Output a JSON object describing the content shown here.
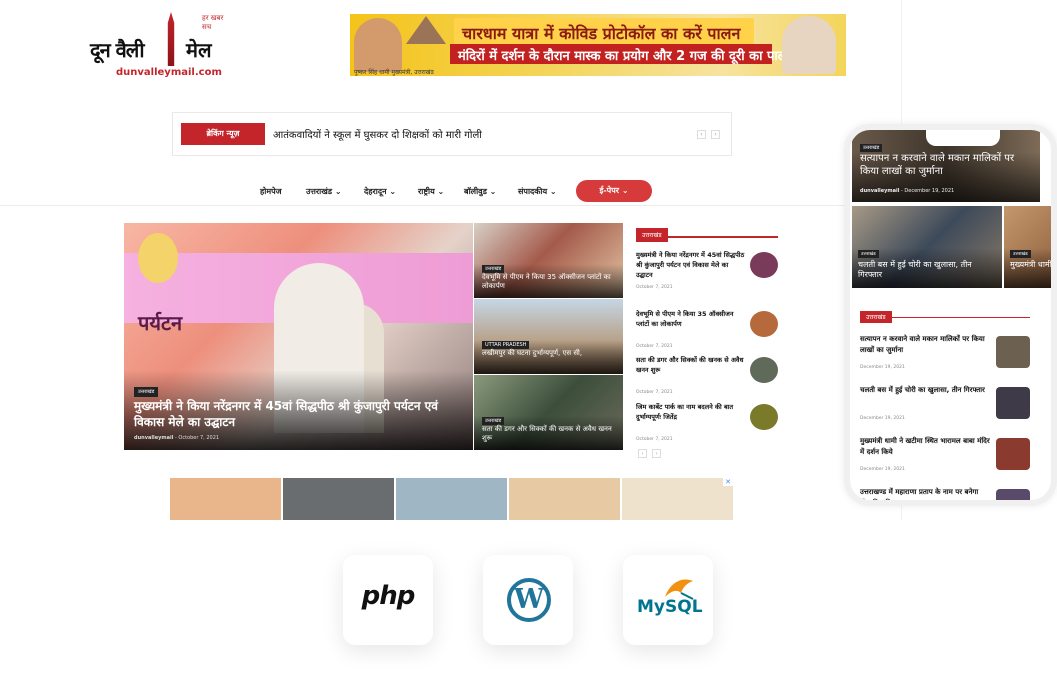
{
  "logo": {
    "name": "दून वैली मेल",
    "left": "दून वैली",
    "right": "मेल",
    "url": "dunvalleymail.com",
    "tagline": "हर खबर सच"
  },
  "ad_top": {
    "line1": "चारधाम यात्रा में कोविड प्रोटोकॉल का करें पालन",
    "line2": "मंदिरों में दर्शन के दौरान मास्क का प्रयोग और 2 गज की दूरी का पालन करें",
    "line3": "पुष्कर सिंह धामी मुख्यमंत्री, उत्तराखंड"
  },
  "breaking": {
    "label": "ब्रेकिंग न्यूज़",
    "text": "आतंकवादियों ने स्कूल में घुसकर दो शिक्षकों को मारी गोली",
    "prev": "‹",
    "next": "›"
  },
  "nav": {
    "items": [
      "होमपेज",
      "उत्तराखंड",
      "देहरादून",
      "राष्ट्रीय",
      "बॉलीवुड",
      "संपादकीय"
    ],
    "epaper": "ई-पेपर"
  },
  "hero": {
    "badge": "उत्तराखंड",
    "title": "मुख्यमंत्री ने किया नरेंद्रनगर में 45वां सिद्धपीठ श्री कुंजापुरी पर्यटन एवं विकास मेले का उद्घाटन",
    "author": "dunvalleymail",
    "date": "October 7, 2021",
    "banner_text": "पर्यटन"
  },
  "tiles": [
    {
      "badge": "उत्तराखंड",
      "title": "देवभूमि से पीएम ने किया 35 ऑक्सीजन प्लांटों का लोकार्पण"
    },
    {
      "badge": "UTTAR PRADESH",
      "title": "लखीमपुर की घटना दुर्भाग्यपूर्ण, एस सी,"
    },
    {
      "badge": "उत्तराखंड",
      "title": "सता की डगर और सिक्कों की खनक से अवैध खनन शुरू"
    }
  ],
  "side": {
    "heading": "उत्तराखंड",
    "items": [
      {
        "title": "मुख्यमंत्री ने किया नरेंद्रनगर में 45वां सिद्धपीठ श्री कुंजापुरी पर्यटन एवं विकास मेले का उद्घाटन",
        "date": "October 7, 2021"
      },
      {
        "title": "देवभूमि से पीएम ने किया 35 ऑक्सीजन प्लांटों का लोकार्पण",
        "date": "October 7, 2021"
      },
      {
        "title": "सता की डगर और सिक्कों की खनक से अवैध खनन शुरू",
        "date": "October 7, 2021"
      },
      {
        "title": "जिम कार्बेट पार्क का नाम बदलने की बात दुर्भाग्यपूर्णः जितेंद्र",
        "date": "October 7, 2021"
      }
    ],
    "prev": "‹",
    "next": "›"
  },
  "ad_bottom": {
    "label": "✕"
  },
  "phone": {
    "hero": {
      "badge": "उत्तराखंड",
      "title": "सत्यापन न करवाने वाले मकान मालिकों पर किया लाखों का जुर्माना",
      "author": "dunvalleymail",
      "date": "December 19, 2021"
    },
    "tiles": [
      {
        "badge": "उत्तराखंड",
        "title": "चलती बस में हुई चोरी का खुलासा, तीन गिरफ्तार"
      },
      {
        "badge": "उत्तराखंड",
        "title": "मुख्यमंत्री धामी ने खटीमा स्थित मंदिर में"
      }
    ],
    "section": "उत्तराखंड",
    "items": [
      {
        "title": "सत्यापन न करवाने वाले मकान मालिकों पर किया लाखों का जुर्माना",
        "date": "December 19, 2021"
      },
      {
        "title": "चलती बस में हुई चोरी का खुलासा, तीन गिरफ्तार",
        "date": "December 19, 2021"
      },
      {
        "title": "मुख्यमंत्री धामी ने खटीमा स्थित भारामल बाबा मंदिर में दर्शन किये",
        "date": "December 19, 2021"
      },
      {
        "title": "उत्तराखण्ड में महाराणा प्रताप के नाम पर बनेगा खेल विश्वविद्यालय",
        "date": ""
      }
    ]
  },
  "tech": {
    "php": "php",
    "wordpress": "W",
    "mysql": "MySQL"
  },
  "colors": {
    "accent": "#c3252b",
    "wordpress": "#21759b",
    "mysql": "#00758f"
  }
}
